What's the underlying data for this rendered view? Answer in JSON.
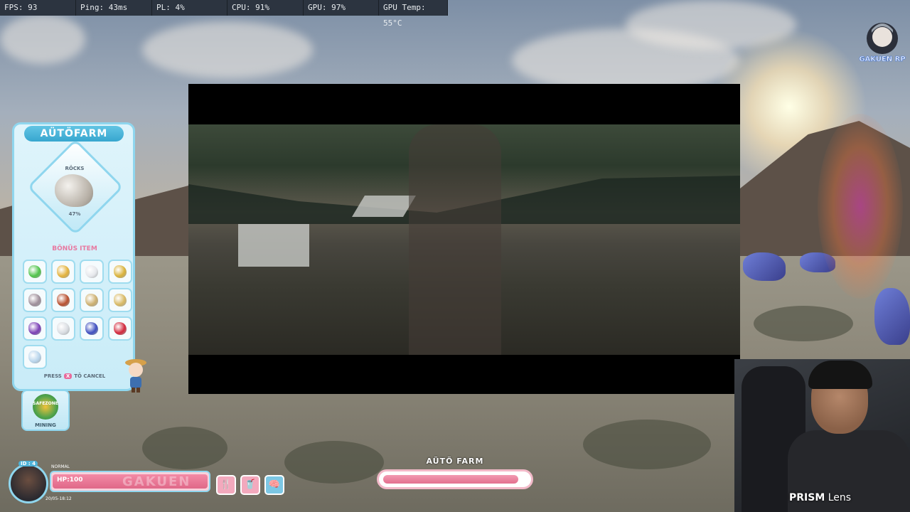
{
  "perf": {
    "fps": "FPS: 93",
    "ping": "Ping: 43ms",
    "pl": "PL: 4%",
    "cpu": "CPU: 91%",
    "gpu": "GPU: 97%",
    "gpu_temp": "GPU Temp: 55°C"
  },
  "logo": {
    "text": "GAKUEN RP"
  },
  "autofarm_panel": {
    "title": "AÜTÖFARM",
    "resource_label": "RÖCKS",
    "resource_count": "47%",
    "bonus_title": "BÖNÜS ITEM",
    "items": [
      {
        "icon": "green-gem-icon",
        "color": "#4fc34a"
      },
      {
        "icon": "gold-nugget-icon",
        "color": "#e3b23c"
      },
      {
        "icon": "silver-ore-icon",
        "color": "#e6e8ec"
      },
      {
        "icon": "gold-ore-icon",
        "color": "#d9b23a"
      },
      {
        "icon": "gray-ore-icon",
        "color": "#9e8f9a"
      },
      {
        "icon": "brick-icon",
        "color": "#b8502f"
      },
      {
        "icon": "sand-pile-icon",
        "color": "#cdb070"
      },
      {
        "icon": "sulfur-icon",
        "color": "#d8b964"
      },
      {
        "icon": "amethyst-icon",
        "color": "#7a3fb5"
      },
      {
        "icon": "quartz-icon",
        "color": "#d9dde2"
      },
      {
        "icon": "sapphire-icon",
        "color": "#3f4fc0"
      },
      {
        "icon": "ruby-icon",
        "color": "#d2283c"
      },
      {
        "icon": "ice-crystal-icon",
        "color": "#b9d5ec"
      }
    ],
    "cancel_prefix": "PRESS",
    "cancel_key": "X",
    "cancel_suffix": "TÖ CANCEL"
  },
  "safezone": {
    "badge": "SAFEZONE",
    "label": "MINING"
  },
  "player_hud": {
    "id": "ID : 4",
    "status": "NORMAL",
    "hp": "HP:100",
    "hp_fraction": 1.0,
    "watermark": "GAKUEN",
    "date": "20/05-18:12"
  },
  "hud_buttons": [
    {
      "name": "food-button",
      "symbol": "🍴"
    },
    {
      "name": "drink-button",
      "symbol": "🥤"
    },
    {
      "name": "brain-button",
      "symbol": "🧠"
    }
  ],
  "autofarm_progress": {
    "label": "AÜTÖ FARM",
    "fraction": 0.92
  },
  "webcam": {
    "brand": "PRISM",
    "brand_suffix": " Lens"
  }
}
